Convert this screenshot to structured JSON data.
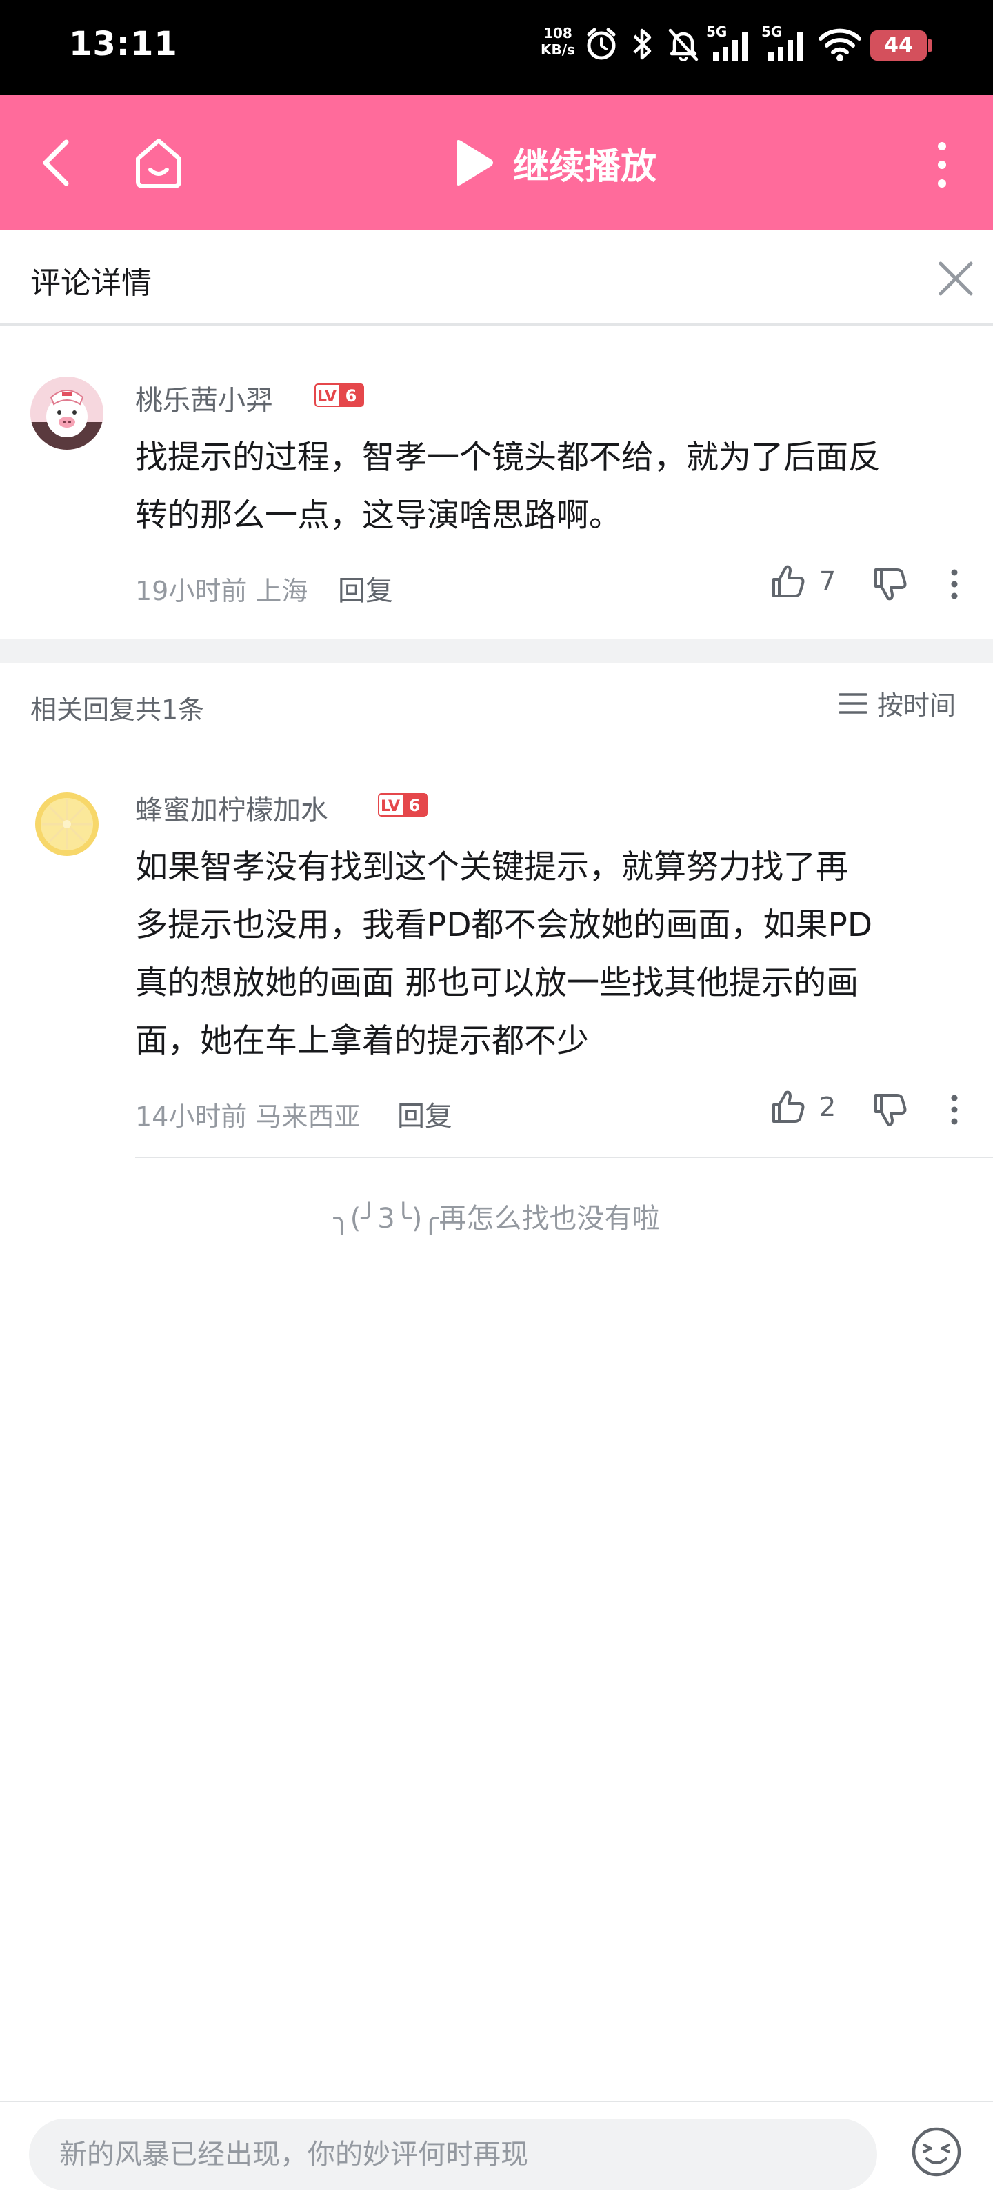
{
  "status_bar": {
    "time": "13:11",
    "net_speed_value": "108",
    "net_speed_unit": "KB/s",
    "signal_1_label": "5G",
    "signal_2_label": "5G",
    "battery": "44"
  },
  "header": {
    "title": "继续播放"
  },
  "detail": {
    "title": "评论详情"
  },
  "main_comment": {
    "username": "桃乐茜小羿",
    "level": "LV6",
    "text_line1": "找提示的过程，智孝一个镜头都不给，就为了后面反",
    "text_line2": "转的那么一点，这导演啥思路啊。",
    "time_location": "19小时前 上海",
    "reply_label": "回复",
    "like_count": "7"
  },
  "replies": {
    "header": "相关回复共1条",
    "sort_label": "按时间",
    "items": [
      {
        "username": "蜂蜜加柠檬加水",
        "level": "LV6",
        "text_line1": "如果智孝没有找到这个关键提示，就算努力找了再",
        "text_line2": "多提示也没用，我看PD都不会放她的画面，如果PD",
        "text_line3": "真的想放她的画面 那也可以放一些找其他提示的画",
        "text_line4": "面，她在车上拿着的提示都不少",
        "time_location": "14小时前 马来西亚",
        "reply_label": "回复",
        "like_count": "2"
      }
    ],
    "end_tip": "╮(╯3╰)╭再怎么找也没有啦"
  },
  "bottom_bar": {
    "placeholder": "新的风暴已经出现，你的妙评何时再现"
  },
  "colors": {
    "brand_pink": "#ff6b9b",
    "level_badge": "#e5474b",
    "text_primary": "#18191c",
    "text_secondary": "#61666d",
    "text_muted": "#9499a0"
  }
}
